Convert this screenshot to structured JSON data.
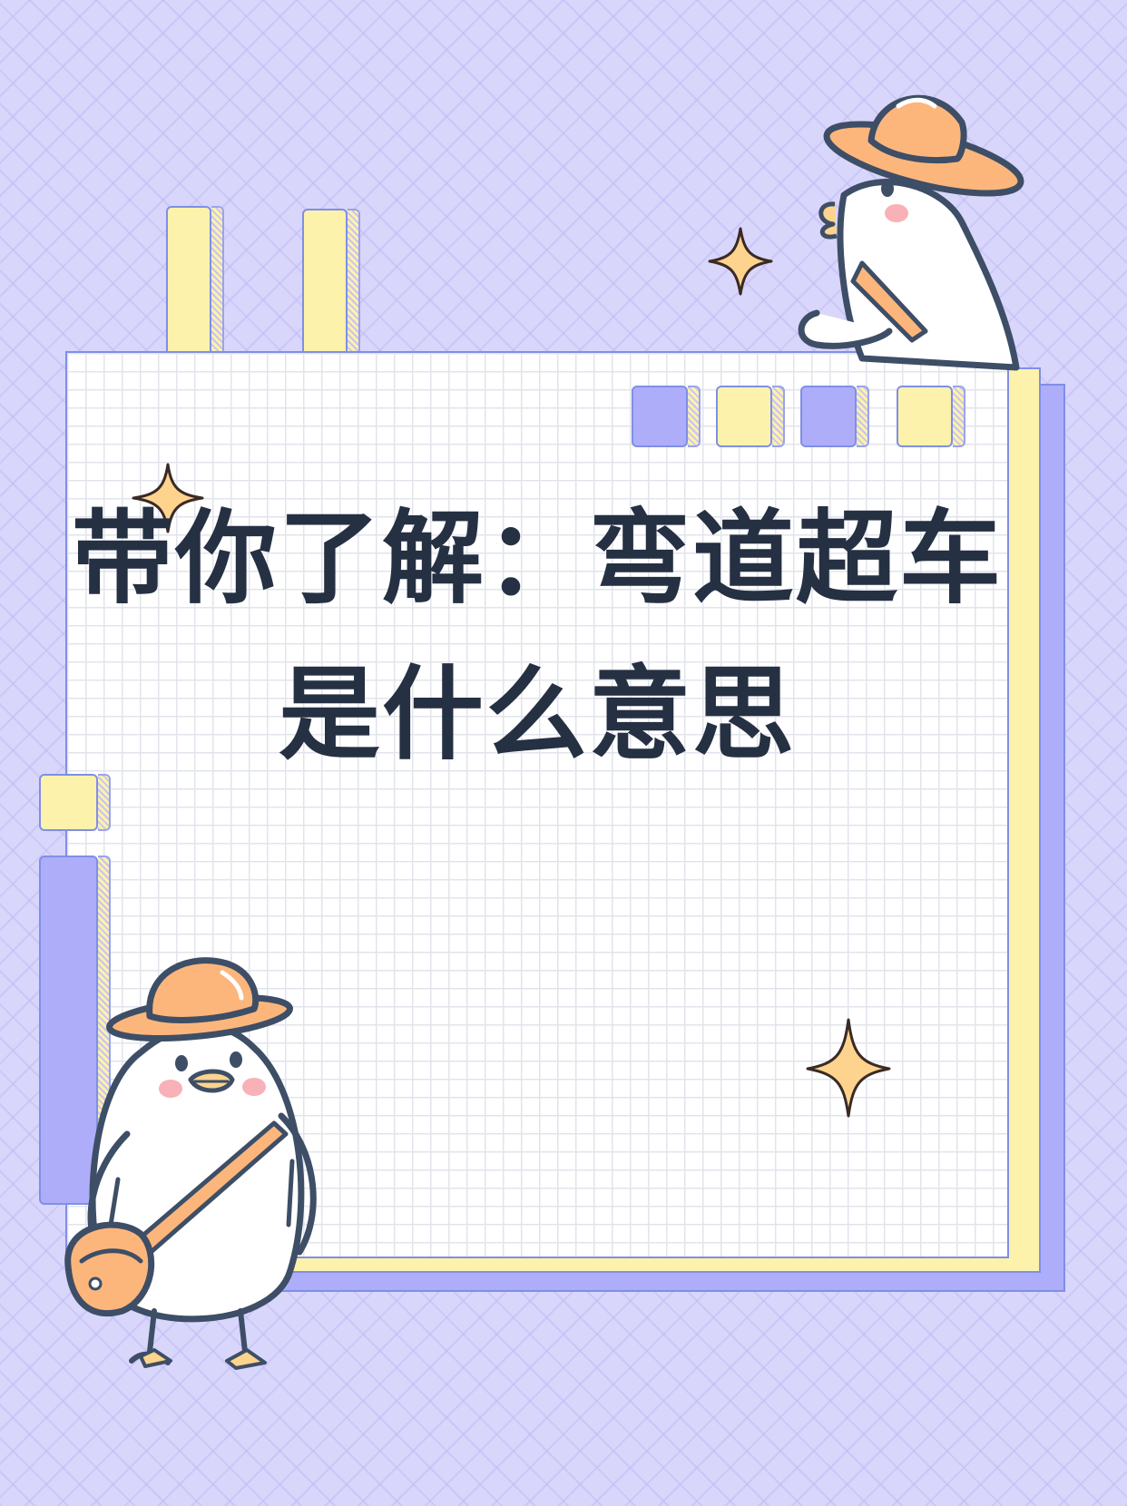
{
  "title": {
    "line1": "带你了解：弯道超车",
    "line2": "是什么意思"
  },
  "colors": {
    "background": "#d9d6fb",
    "title_text": "#253043",
    "accent_yellow": "#fdf2ab",
    "accent_purple": "#aeadf9",
    "outline": "#7f8fe6",
    "hat_orange": "#fcb67c"
  },
  "decorations": [
    "duck-with-hat-top-right",
    "duck-with-hat-and-bag-bottom-left",
    "sparkle-star",
    "grid-paper-sheet",
    "tab-strips"
  ]
}
